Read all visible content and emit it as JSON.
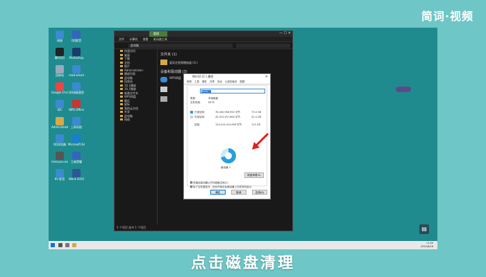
{
  "brand": "简词·视频",
  "caption": "点击磁盘清理",
  "desktop_icons": [
    {
      "label": "网络",
      "color": "#3a8bd1"
    },
    {
      "label": "腾讯QQ",
      "color": "#222"
    },
    {
      "label": "回收站",
      "color": "#9ab"
    },
    {
      "label": "Google Chrome",
      "color": "#e44"
    },
    {
      "label": "IDC",
      "color": "#3a8bd1"
    },
    {
      "label": "Administrator",
      "color": "#d4a94a"
    },
    {
      "label": "QQ浏览器",
      "color": "#3a8bd1"
    },
    {
      "label": "imissyou.exe",
      "color": "#555"
    },
    {
      "label": "KV 影音",
      "color": "#3a8bd1"
    },
    {
      "label": "QQ影音",
      "color": "#36b"
    },
    {
      "label": "Photoshop",
      "color": "#1c3b6b"
    },
    {
      "label": "read.wlcod",
      "color": "#3a8bd1"
    },
    {
      "label": "QQ电脑管家",
      "color": "#3a8bd1"
    },
    {
      "label": "WPS Office",
      "color": "#c33"
    },
    {
      "label": "上网导航",
      "color": "#3a8bd1"
    },
    {
      "label": "Microsoft Edge",
      "color": "#1a7ed1"
    },
    {
      "label": "王者荣耀",
      "color": "#36b"
    },
    {
      "label": "Word 2010",
      "color": "#2b5797"
    }
  ],
  "explorer": {
    "tab_label": "管理",
    "ribbon": [
      "文件",
      "计算机",
      "查看",
      "驱动器工具"
    ],
    "address": "此电脑",
    "nav_items": [
      "快速访问",
      "桌面",
      "下载",
      "文档",
      "图片",
      "Administrator",
      "播放列表",
      "此电脑",
      "回收站",
      "10.1播放",
      "10.1播放",
      "新建文件夹",
      "WPS网盘",
      "最近",
      "星标",
      "我的云文档",
      "共享",
      "此电脑",
      "网络"
    ],
    "folders_header": "文件夹 (1)",
    "folder_name": "爱奇艺视频播放器 (G:)",
    "drives_header": "设备和驱动器 (3)",
    "drive_wps": "WPS网盘",
    "status": "5 个项目   选中 1 个项目"
  },
  "dialog": {
    "title": "Win10 (C:) 属性",
    "close": "×",
    "tabs": [
      "常规",
      "工具",
      "硬件",
      "共享",
      "安全",
      "以前的版本",
      "配额"
    ],
    "name_value": "Win10",
    "type_label": "类型:",
    "type_value": "本地磁盘",
    "fs_label": "文件系统:",
    "fs_value": "NTFS",
    "used_label": "已用空间:",
    "used_bytes": "78,400,956,992 字节",
    "used_gb": "73.0 GB",
    "free_label": "可用空间:",
    "free_bytes": "45,513,457,664 字节",
    "free_gb": "42.4 GB",
    "cap_label": "容量:",
    "cap_bytes": "124,014,414,656 字节",
    "cap_gb": "115 GB",
    "drive_label": "驱动器 C:",
    "cleanup_button": "磁盘清理(D)",
    "check1": "压缩此驱动器以节约磁盘空间(C)",
    "check2": "除了文件属性外，还允许索引此驱动器上文件的内容(I)",
    "ok": "确定",
    "cancel": "取消",
    "apply": "应用(A)",
    "used_fraction": 0.72
  },
  "taskbar": {
    "time": "11:40",
    "date": "2021/6/16"
  }
}
